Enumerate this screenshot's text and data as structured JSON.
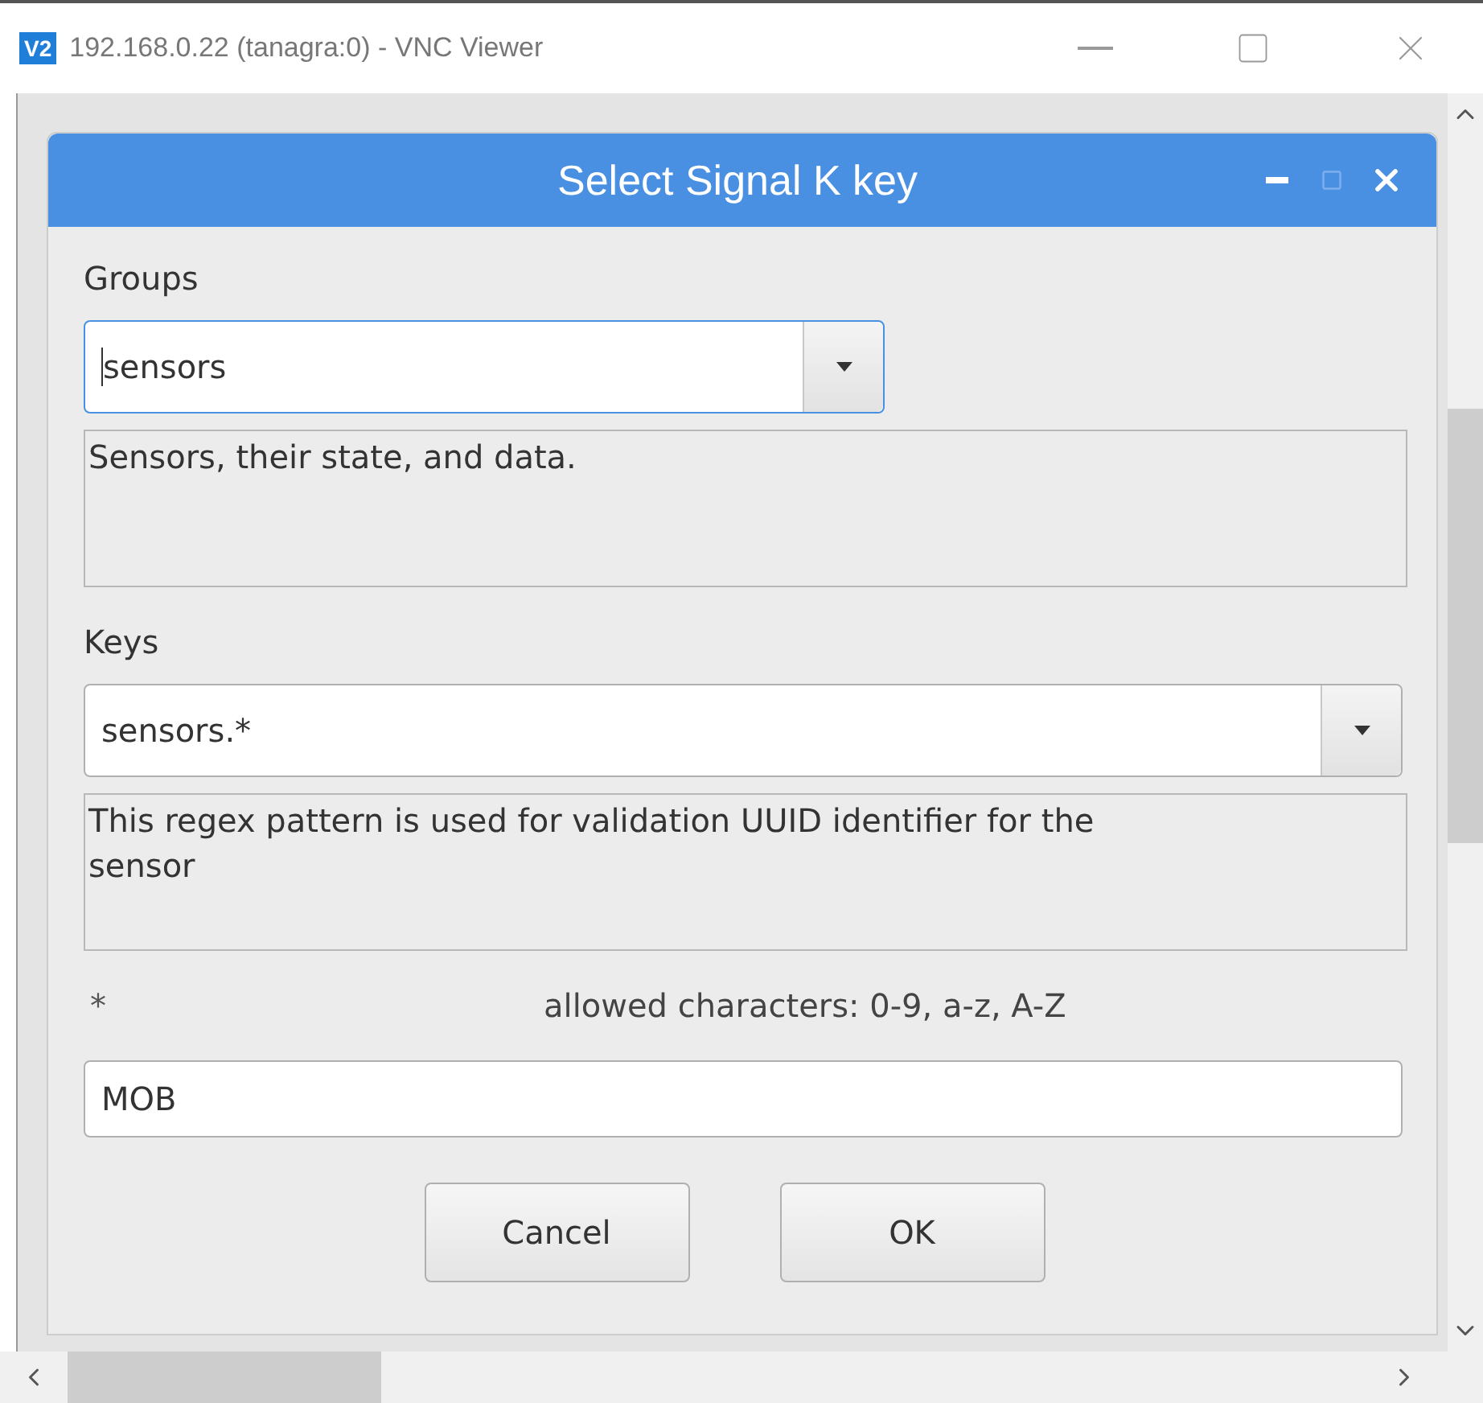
{
  "vnc_window": {
    "badge": "V2",
    "title": "192.168.0.22 (tanagra:0) - VNC Viewer"
  },
  "dialog": {
    "title": "Select Signal K key"
  },
  "groups": {
    "label": "Groups",
    "value": "sensors",
    "focused": true,
    "description": "Sensors, their state, and data."
  },
  "keys": {
    "label": "Keys",
    "value": "sensors.*",
    "focused": false,
    "description": "This regex pattern is used for validation UUID identifier for the sensor"
  },
  "wildcard": {
    "label": "*",
    "hint": "allowed characters: 0-9, a-z, A-Z",
    "value": "MOB"
  },
  "buttons": [
    "Cancel",
    "OK"
  ]
}
